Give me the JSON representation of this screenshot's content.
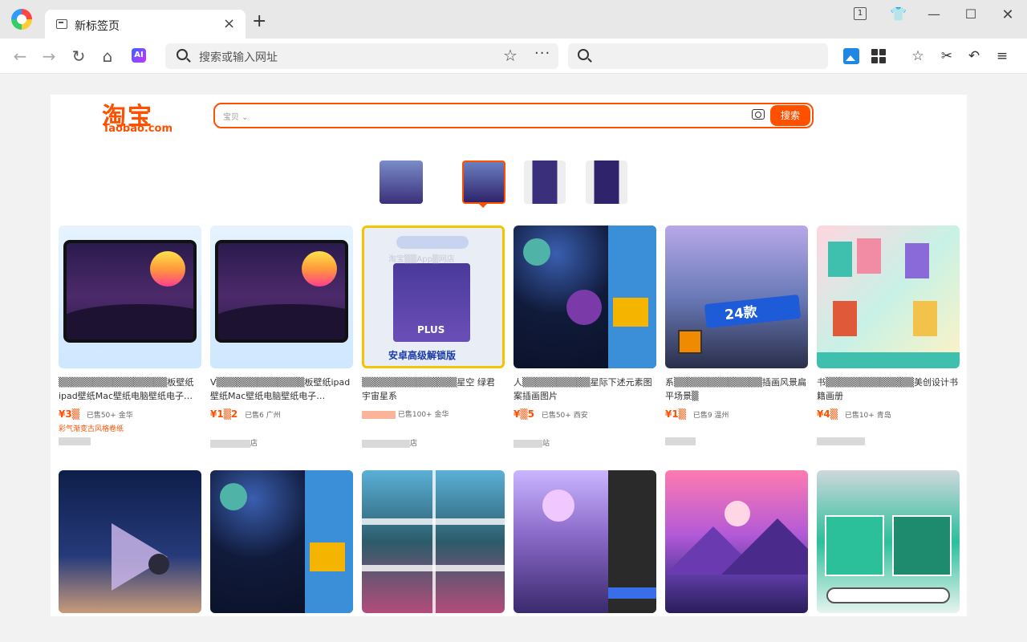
{
  "browser": {
    "tab_title": "新标签页",
    "tab_close": "×",
    "new_tab": "+",
    "address_placeholder": "搜索或输入网址",
    "ai_label": "AI",
    "tab_count": "1",
    "icons": [
      "back-icon",
      "forward-icon",
      "reload-icon",
      "home-icon",
      "star-icon",
      "more-icon",
      "search-icon",
      "image-search-icon",
      "apps-icon",
      "favorites-icon",
      "scissors-icon",
      "undo-icon",
      "menu-icon"
    ]
  },
  "taobao": {
    "logo_cn": "淘宝",
    "logo_en": "Taobao.com",
    "search_scope": "宝贝 ⌄",
    "search_button": "搜索"
  },
  "products": [
    {
      "title": "▒▒▒▒▒▒▒▒▒▒▒▒▒▒▒▒板壁纸ipad壁纸Mac壁纸电脑壁纸电子…",
      "price": "¥3▒",
      "sold": "已售50+",
      "location": "金华",
      "promo": "彩气渐变古风格卷纸",
      "shop": ""
    },
    {
      "title": "V▒▒▒▒▒▒▒▒▒▒▒▒▒板壁纸ipad壁纸Mac壁纸电脑壁纸电子…",
      "price": "¥1▒2",
      "sold": "已售6",
      "location": "广州",
      "promo": "",
      "shop": "店"
    },
    {
      "title": "▒▒▒▒▒▒▒▒▒▒▒▒▒▒星空 绿君 宇宙星系",
      "price": "",
      "sold": "已售100+",
      "location": "金华",
      "promo": "",
      "shop": "店"
    },
    {
      "title": "人▒▒▒▒▒▒▒▒▒▒星际下述元素图案插画图片",
      "price": "¥▒5",
      "sold": "已售50+",
      "location": "西安",
      "promo": "",
      "shop": "站"
    },
    {
      "title": "系▒▒▒▒▒▒▒▒▒▒▒▒▒插画风景扁平场景▒",
      "price": "¥1▒",
      "sold": "已售9",
      "location": "温州",
      "promo": "",
      "shop": ""
    },
    {
      "title": "书▒▒▒▒▒▒▒▒▒▒▒▒▒美创设计书籍画册",
      "price": "¥4▒",
      "sold": "已售10+",
      "location": "青岛",
      "promo": "",
      "shop": ""
    }
  ],
  "overlays": {
    "plus": "PLUS",
    "banner": "安卓高级解锁版",
    "badge_count": "24款",
    "watermark": "淘宝▒▒App▒网店"
  }
}
